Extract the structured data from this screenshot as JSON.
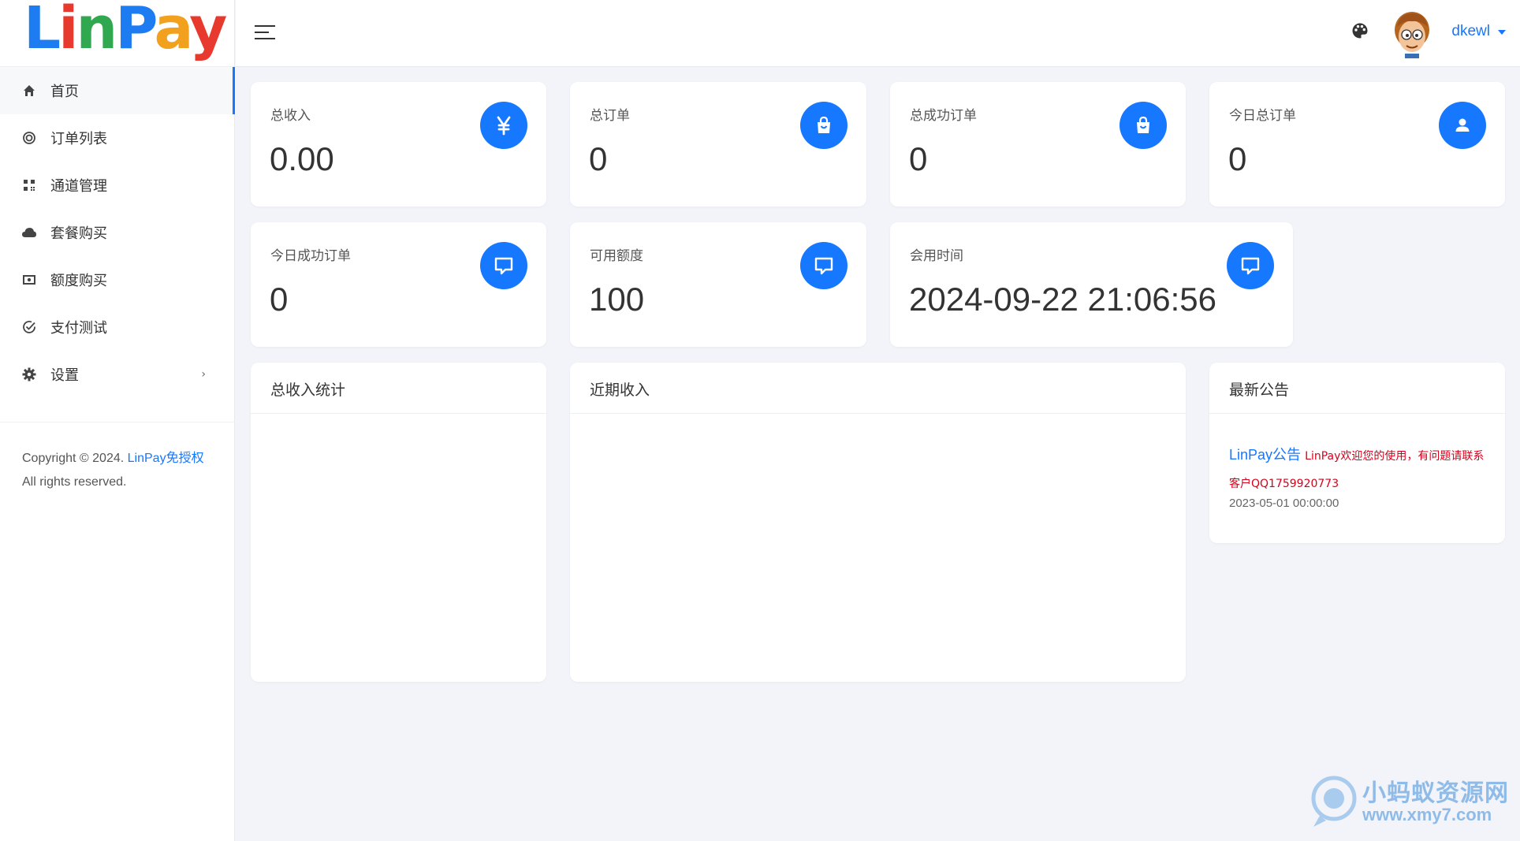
{
  "brand": {
    "logo_text": "LinPay",
    "colors": {
      "accent": "#1677ff",
      "notice_red": "#d9001b"
    }
  },
  "sidebar": {
    "items": [
      {
        "label": "首页",
        "icon": "home-icon",
        "active": true
      },
      {
        "label": "订单列表",
        "icon": "circle-icon"
      },
      {
        "label": "通道管理",
        "icon": "qrcode-icon"
      },
      {
        "label": "套餐购买",
        "icon": "cloud-icon"
      },
      {
        "label": "额度购买",
        "icon": "money-icon"
      },
      {
        "label": "支付测试",
        "icon": "check-circle-icon"
      },
      {
        "label": "设置",
        "icon": "gear-icon",
        "has_submenu": true
      }
    ],
    "copyright_prefix": "Copyright © 2024. ",
    "copyright_link": "LinPay免授权",
    "copyright_suffix": " All rights reserved."
  },
  "header": {
    "username": "dkewl"
  },
  "stats": [
    {
      "label": "总收入",
      "value": "0.00",
      "icon": "yen-icon"
    },
    {
      "label": "总订单",
      "value": "0",
      "icon": "shopping-bag-icon"
    },
    {
      "label": "总成功订单",
      "value": "0",
      "icon": "shopping-bag-icon"
    },
    {
      "label": "今日总订单",
      "value": "0",
      "icon": "user-icon"
    },
    {
      "label": "今日成功订单",
      "value": "0",
      "icon": "message-icon"
    },
    {
      "label": "可用额度",
      "value": "100",
      "icon": "message-icon"
    },
    {
      "label": "会用时间",
      "value": "2024-09-22 21:06:56",
      "icon": "message-icon"
    }
  ],
  "panels": {
    "total_income_stats": {
      "title": "总收入统计"
    },
    "recent_income": {
      "title": "近期收入"
    },
    "announcements": {
      "title": "最新公告",
      "item": {
        "title": "LinPay公告",
        "body": "LinPay欢迎您的使用，有问题请联系客户QQ1759920773",
        "date": "2023-05-01 00:00:00"
      }
    }
  },
  "watermark": {
    "text_cn": "小蚂蚁资源网",
    "url": "www.xmy7.com"
  }
}
